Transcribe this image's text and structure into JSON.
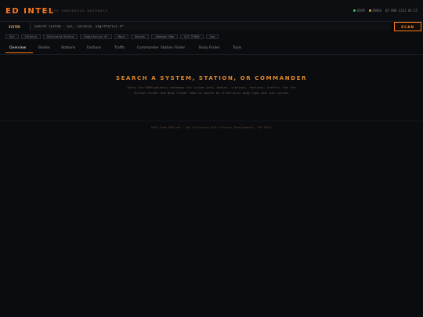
{
  "header": {
    "logo": "ED INTEL",
    "tagline": "ELITE DANGEROUS DATABASE",
    "status": [
      {
        "label": "EDSM",
        "color": "#3cc25a"
      },
      {
        "label": "INARA",
        "color": "#e2a23b"
      }
    ],
    "datetime": "05 MAR 3311 01:35"
  },
  "search": {
    "label": "SYSTEM",
    "placeholder": "Search system - Sol, Colonia, Sagittarius A*",
    "button": "SCAN"
  },
  "quick_links": [
    "Sol",
    "Colonia",
    "Shinrarta Dezhra",
    "Sagittarius A*",
    "Maia",
    "Deciat",
    "Jameson Mem",
    "CoT 3790A",
    "Jaq"
  ],
  "tabs": [
    {
      "label": "Overview",
      "active": true
    },
    {
      "label": "Bodies",
      "active": false
    },
    {
      "label": "Stations",
      "active": false
    },
    {
      "label": "Factions",
      "active": false
    },
    {
      "label": "Traffic",
      "active": false
    },
    {
      "label": "Commander",
      "active": false
    },
    {
      "label": "Station Finder",
      "active": false
    },
    {
      "label": "Body Finder",
      "active": false
    },
    {
      "label": "Tools",
      "active": false
    }
  ],
  "hero": {
    "title": "SEARCH A SYSTEM, STATION, OR COMMANDER",
    "description": "Query the EDSM galactic database for system info, bodies, stations, factions, traffic. Use the Station Finder and Body Finder tabs to search by criteria or body type near any system."
  },
  "footer": "Data from EDSM.net · Not affiliated with Frontier Developments · ED INTEL"
}
